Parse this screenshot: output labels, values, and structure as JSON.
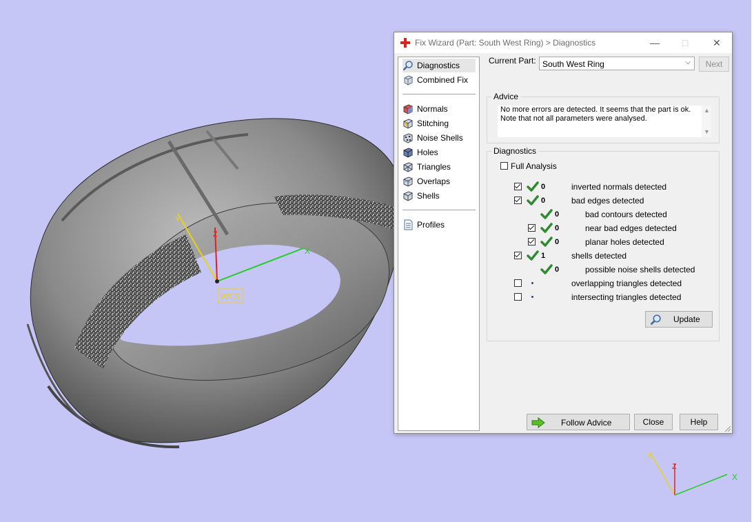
{
  "viewport": {
    "background": "#c6c6f6",
    "wcs_label": "WCS",
    "axes": {
      "x": "X",
      "y": "Y",
      "z": "Z"
    },
    "mini_axes": {
      "x": "X",
      "y": "Y",
      "z": "Z"
    }
  },
  "dialog": {
    "title": "Fix Wizard (Part: South West Ring) > Diagnostics",
    "nav": [
      {
        "label": "Diagnostics",
        "icon": "magnifier-icon",
        "selected": true
      },
      {
        "label": "Combined Fix",
        "icon": "combined-fix-icon"
      },
      {
        "label": "Normals",
        "icon": "normals-icon"
      },
      {
        "label": "Stitching",
        "icon": "stitching-icon"
      },
      {
        "label": "Noise Shells",
        "icon": "noise-shells-icon"
      },
      {
        "label": "Holes",
        "icon": "holes-icon"
      },
      {
        "label": "Triangles",
        "icon": "triangles-icon"
      },
      {
        "label": "Overlaps",
        "icon": "overlaps-icon"
      },
      {
        "label": "Shells",
        "icon": "shells-icon"
      },
      {
        "label": "Profiles",
        "icon": "profiles-icon"
      }
    ],
    "current_part_label": "Current Part:",
    "current_part_value": "South West Ring",
    "next_label": "Next",
    "advice_title": "Advice",
    "advice_text": "No more errors are detected. It seems that the part is ok.\nNote that not all parameters were analysed.",
    "diagnostics_title": "Diagnostics",
    "full_analysis_label": "Full Analysis",
    "rows": [
      {
        "checked": true,
        "status": "ok",
        "count": "0",
        "label": "inverted normals detected"
      },
      {
        "checked": true,
        "status": "ok",
        "count": "0",
        "label": "bad edges detected"
      },
      {
        "checkbox": false,
        "status": "ok",
        "count": "0",
        "label": "bad contours detected"
      },
      {
        "checked": true,
        "status": "ok",
        "count": "0",
        "label": "near bad edges detected"
      },
      {
        "checked": true,
        "status": "ok",
        "count": "0",
        "label": "planar holes detected"
      },
      {
        "checked": true,
        "status": "ok",
        "count": "1",
        "label": "shells detected"
      },
      {
        "checkbox": false,
        "status": "ok",
        "count": "0",
        "label": "possible noise shells detected"
      },
      {
        "checked": false,
        "status": "pending",
        "count": "",
        "label": "overlapping triangles detected"
      },
      {
        "checked": false,
        "status": "pending",
        "count": "",
        "label": "intersecting triangles detected"
      }
    ],
    "update_label": "Update",
    "follow_advice_label": "Follow Advice",
    "close_label": "Close",
    "help_label": "Help"
  },
  "colors": {
    "accent_green": "#2e8b2e",
    "close_red": "#d9241c",
    "axis_x": "#22cc22",
    "axis_y": "#e8d21a",
    "axis_z": "#e02020"
  }
}
